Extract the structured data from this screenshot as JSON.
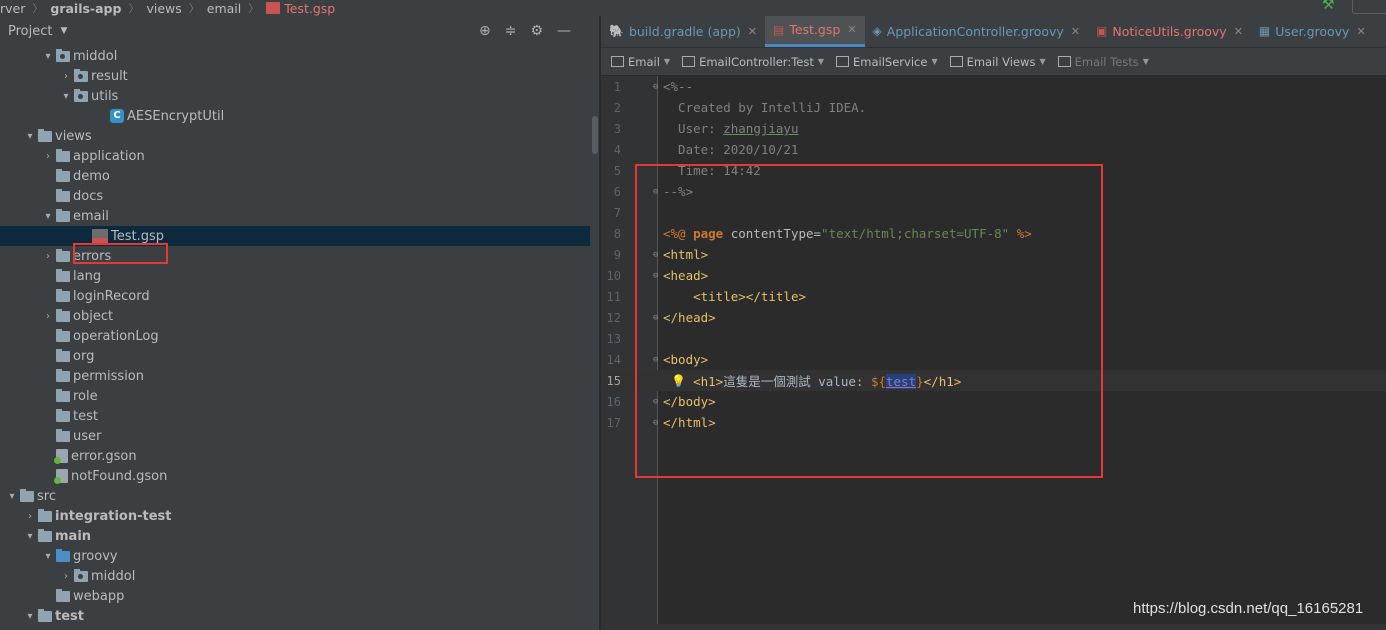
{
  "breadcrumb": {
    "items": [
      "rver",
      "grails-app",
      "views",
      "email",
      "Test.gsp"
    ]
  },
  "project": {
    "title": "Project",
    "tree": [
      {
        "label": "middol",
        "indent": 2,
        "arrow": "down",
        "icon": "folder-pkg"
      },
      {
        "label": "result",
        "indent": 3,
        "arrow": "right",
        "icon": "folder-pkg"
      },
      {
        "label": "utils",
        "indent": 3,
        "arrow": "down",
        "icon": "folder-pkg"
      },
      {
        "label": "AESEncryptUtil",
        "indent": 5,
        "arrow": "none",
        "icon": "class"
      },
      {
        "label": "views",
        "indent": 1,
        "arrow": "down",
        "icon": "folder-views"
      },
      {
        "label": "application",
        "indent": 2,
        "arrow": "right",
        "icon": "folder"
      },
      {
        "label": "demo",
        "indent": 2,
        "arrow": "none",
        "icon": "folder"
      },
      {
        "label": "docs",
        "indent": 2,
        "arrow": "none",
        "icon": "folder"
      },
      {
        "label": "email",
        "indent": 2,
        "arrow": "down",
        "icon": "folder"
      },
      {
        "label": "Test.gsp",
        "indent": 4,
        "arrow": "none",
        "icon": "gsp",
        "selected": true
      },
      {
        "label": "errors",
        "indent": 2,
        "arrow": "right",
        "icon": "folder"
      },
      {
        "label": "lang",
        "indent": 2,
        "arrow": "none",
        "icon": "folder"
      },
      {
        "label": "loginRecord",
        "indent": 2,
        "arrow": "none",
        "icon": "folder"
      },
      {
        "label": "object",
        "indent": 2,
        "arrow": "right",
        "icon": "folder"
      },
      {
        "label": "operationLog",
        "indent": 2,
        "arrow": "none",
        "icon": "folder"
      },
      {
        "label": "org",
        "indent": 2,
        "arrow": "none",
        "icon": "folder"
      },
      {
        "label": "permission",
        "indent": 2,
        "arrow": "none",
        "icon": "folder"
      },
      {
        "label": "role",
        "indent": 2,
        "arrow": "none",
        "icon": "folder"
      },
      {
        "label": "test",
        "indent": 2,
        "arrow": "none",
        "icon": "folder"
      },
      {
        "label": "user",
        "indent": 2,
        "arrow": "none",
        "icon": "folder"
      },
      {
        "label": "error.gson",
        "indent": 2,
        "arrow": "none",
        "icon": "gson"
      },
      {
        "label": "notFound.gson",
        "indent": 2,
        "arrow": "none",
        "icon": "gson"
      },
      {
        "label": "src",
        "indent": 0,
        "arrow": "down",
        "icon": "folder"
      },
      {
        "label": "integration-test",
        "indent": 1,
        "arrow": "right",
        "icon": "folder-src",
        "bold": true
      },
      {
        "label": "main",
        "indent": 1,
        "arrow": "down",
        "icon": "folder-src",
        "bold": true
      },
      {
        "label": "groovy",
        "indent": 2,
        "arrow": "down",
        "icon": "folder-blue"
      },
      {
        "label": "middol",
        "indent": 3,
        "arrow": "right",
        "icon": "folder-pkg"
      },
      {
        "label": "webapp",
        "indent": 2,
        "arrow": "none",
        "icon": "folder-web"
      },
      {
        "label": "test",
        "indent": 1,
        "arrow": "down",
        "icon": "folder-src",
        "bold": true
      }
    ]
  },
  "tabs": [
    {
      "label": "build.gradle (app)",
      "icon": "gradle-icon",
      "color": "blue",
      "active": false
    },
    {
      "label": "Test.gsp",
      "icon": "gsp-icon",
      "color": "red",
      "active": true
    },
    {
      "label": "ApplicationController.groovy",
      "icon": "groovy-controller-icon",
      "color": "blue",
      "active": false
    },
    {
      "label": "NoticeUtils.groovy",
      "icon": "groovy-class-icon",
      "color": "red",
      "active": false
    },
    {
      "label": "User.groovy",
      "icon": "table-icon",
      "color": "blue",
      "active": false
    }
  ],
  "subtools": [
    {
      "label": "Email",
      "dim": false
    },
    {
      "label": "EmailController:Test",
      "dim": false
    },
    {
      "label": "EmailService",
      "dim": false
    },
    {
      "label": "Email Views",
      "dim": false
    },
    {
      "label": "Email Tests",
      "dim": true
    }
  ],
  "editor": {
    "current_line": 15,
    "lines": [
      "<%--",
      "  Created by IntelliJ IDEA.",
      "  User: zhangjiayu",
      "  Date: 2020/10/21",
      "  Time: 14:42",
      "--%>",
      "",
      "<%@ page contentType=\"text/html;charset=UTF-8\" %>",
      "<html>",
      "<head>",
      "    <title></title>",
      "</head>",
      "",
      "<body>",
      "    <h1>這隻是一個測試 value: ${test}</h1>",
      "</body>",
      "</html>"
    ]
  },
  "watermark": "https://blog.csdn.net/qq_16165281"
}
